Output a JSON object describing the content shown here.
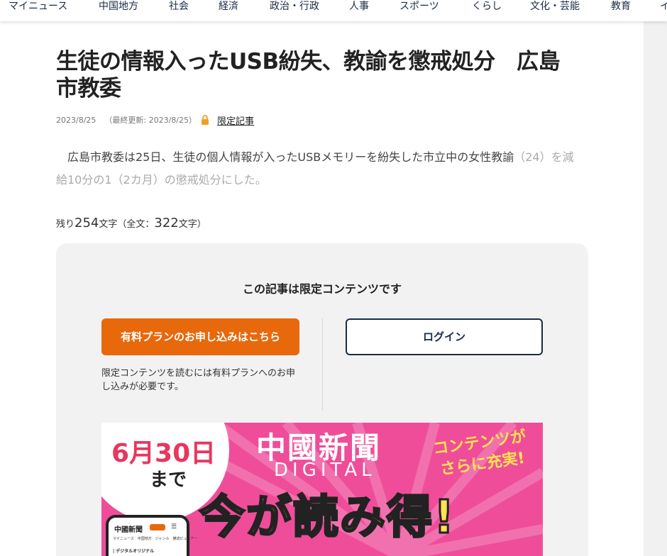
{
  "nav": {
    "items": [
      "マイニュース",
      "中国地方",
      "社会",
      "経済",
      "政治・行政",
      "人事",
      "スポーツ",
      "くらし",
      "文化・芸能",
      "教育",
      "イ"
    ]
  },
  "article": {
    "title": "生徒の情報入ったUSB紛失、教諭を懲戒処分　広島市教委",
    "date": "2023/8/25",
    "updated": "（最終更新: 2023/8/25）",
    "limited_label": "限定記事",
    "lead_visible": "　広島市教委は25日、生徒の個人情報が入ったUSBメモリーを紛失した市立中の女性教諭",
    "lead_faded": "（24）を減給10分の1（2カ月）の懲戒処分にした。",
    "remain_prefix": "残り",
    "remain_count": "254",
    "remain_mid": "文字（全文：",
    "total_count": "322",
    "remain_suffix": "文字）"
  },
  "paywall": {
    "title": "この記事は限定コンテンツです",
    "subscribe_label": "有料プランのお申し込みはこちら",
    "login_label": "ログイン",
    "note": "限定コンテンツを読むには有料プランへのお申し込みが必要です。"
  },
  "banner": {
    "date": "6月30日",
    "until": "まで",
    "brand": "中國新聞",
    "digital": "DIGITAL",
    "more": "コンテンツがさらに充実!",
    "headline": "今が読み得!",
    "phone_logo": "中國新聞",
    "phone_menu": "☰",
    "phone_tabs": "マイニュース　中国地方　ジャンル　横流ビューアー",
    "phone_section": "| デジタルオリジナル"
  },
  "colors": {
    "accent_orange": "#e8680c",
    "navy": "#1a2b48",
    "banner_pink": "#ef4d9a",
    "banner_yellow": "#ffe44d",
    "date_red": "#e8365f"
  },
  "icons": {
    "lock": "lock-icon"
  }
}
